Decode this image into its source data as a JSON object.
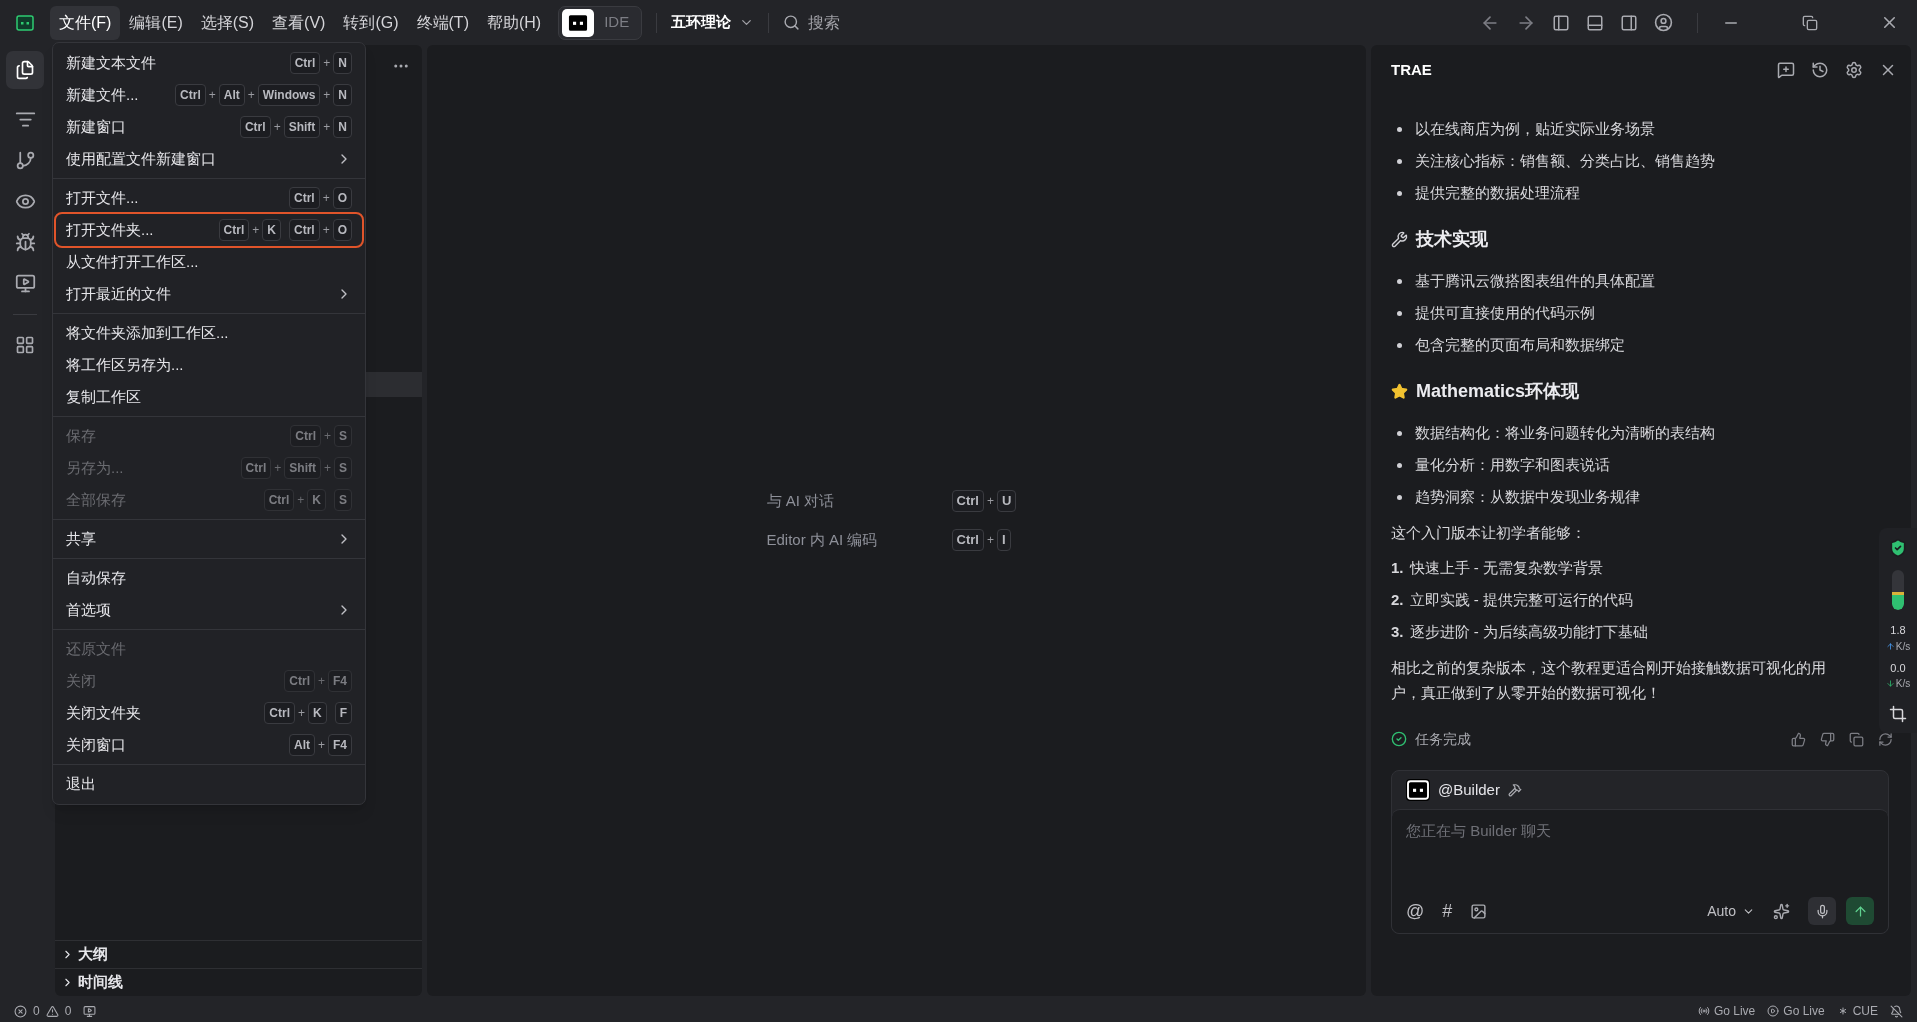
{
  "menubar": [
    {
      "label": "文件(F)",
      "selected": true
    },
    {
      "label": "编辑(E)",
      "selected": false
    },
    {
      "label": "选择(S)",
      "selected": false
    },
    {
      "label": "查看(V)",
      "selected": false
    },
    {
      "label": "转到(G)",
      "selected": false
    },
    {
      "label": "终端(T)",
      "selected": false
    },
    {
      "label": "帮助(H)",
      "selected": false
    }
  ],
  "mode_toggle": {
    "label": "IDE"
  },
  "project": {
    "name": "五环理论"
  },
  "search": {
    "placeholder": "搜索"
  },
  "file_menu": [
    [
      {
        "label": "新建文本文件",
        "disabled": false,
        "highlighted": false,
        "submenu": false,
        "shortcut": [
          [
            "Ctrl",
            "+",
            "N"
          ]
        ]
      },
      {
        "label": "新建文件...",
        "disabled": false,
        "highlighted": false,
        "submenu": false,
        "shortcut": [
          [
            "Ctrl",
            "+",
            "Alt",
            "+",
            "Windows",
            "+",
            "N"
          ]
        ]
      },
      {
        "label": "新建窗口",
        "disabled": false,
        "highlighted": false,
        "submenu": false,
        "shortcut": [
          [
            "Ctrl",
            "+",
            "Shift",
            "+",
            "N"
          ]
        ]
      },
      {
        "label": "使用配置文件新建窗口",
        "disabled": false,
        "highlighted": false,
        "submenu": true
      }
    ],
    [
      {
        "label": "打开文件...",
        "disabled": false,
        "highlighted": false,
        "submenu": false,
        "shortcut": [
          [
            "Ctrl",
            "+",
            "O"
          ]
        ]
      },
      {
        "label": "打开文件夹...",
        "disabled": false,
        "highlighted": true,
        "submenu": false,
        "shortcut": [
          [
            "Ctrl",
            "+",
            "K"
          ],
          [
            "Ctrl",
            "+",
            "O"
          ]
        ]
      },
      {
        "label": "从文件打开工作区...",
        "disabled": false,
        "highlighted": false,
        "submenu": false
      },
      {
        "label": "打开最近的文件",
        "disabled": false,
        "highlighted": false,
        "submenu": true
      }
    ],
    [
      {
        "label": "将文件夹添加到工作区...",
        "disabled": false,
        "highlighted": false,
        "submenu": false
      },
      {
        "label": "将工作区另存为...",
        "disabled": false,
        "highlighted": false,
        "submenu": false
      },
      {
        "label": "复制工作区",
        "disabled": false,
        "highlighted": false,
        "submenu": false
      }
    ],
    [
      {
        "label": "保存",
        "disabled": true,
        "highlighted": false,
        "submenu": false,
        "shortcut": [
          [
            "Ctrl",
            "+",
            "S"
          ]
        ]
      },
      {
        "label": "另存为...",
        "disabled": true,
        "highlighted": false,
        "submenu": false,
        "shortcut": [
          [
            "Ctrl",
            "+",
            "Shift",
            "+",
            "S"
          ]
        ]
      },
      {
        "label": "全部保存",
        "disabled": true,
        "highlighted": false,
        "submenu": false,
        "shortcut": [
          [
            "Ctrl",
            "+",
            "K"
          ],
          [
            "S"
          ]
        ]
      }
    ],
    [
      {
        "label": "共享",
        "disabled": false,
        "highlighted": false,
        "submenu": true
      }
    ],
    [
      {
        "label": "自动保存",
        "disabled": false,
        "highlighted": false,
        "submenu": false
      },
      {
        "label": "首选项",
        "disabled": false,
        "highlighted": false,
        "submenu": true
      }
    ],
    [
      {
        "label": "还原文件",
        "disabled": true,
        "highlighted": false,
        "submenu": false
      },
      {
        "label": "关闭",
        "disabled": true,
        "highlighted": false,
        "submenu": false,
        "shortcut": [
          [
            "Ctrl",
            "+",
            "F4"
          ]
        ]
      },
      {
        "label": "关闭文件夹",
        "disabled": false,
        "highlighted": false,
        "submenu": false,
        "shortcut": [
          [
            "Ctrl",
            "+",
            "K"
          ],
          [
            "F"
          ]
        ]
      },
      {
        "label": "关闭窗口",
        "disabled": false,
        "highlighted": false,
        "submenu": false,
        "shortcut": [
          [
            "Alt",
            "+",
            "F4"
          ]
        ]
      }
    ],
    [
      {
        "label": "退出",
        "disabled": false,
        "highlighted": false,
        "submenu": false
      }
    ]
  ],
  "sidebar_sections": [
    {
      "label": "大纲",
      "expanded": false
    },
    {
      "label": "时间线",
      "expanded": false
    }
  ],
  "editor_hints": [
    {
      "label": "与 AI 对话",
      "keys": [
        "Ctrl",
        "+",
        "U"
      ]
    },
    {
      "label": "Editor 内 AI 编码",
      "keys": [
        "Ctrl",
        "+",
        "I"
      ]
    }
  ],
  "chat": {
    "title": "TRAE",
    "blocks": [
      {
        "kind": "bullet",
        "text": "以在线商店为例，贴近实际业务场景"
      },
      {
        "kind": "bullet",
        "text": "关注核心指标：销售额、分类占比、销售趋势"
      },
      {
        "kind": "bullet",
        "text": "提供完整的数据处理流程"
      },
      {
        "kind": "heading",
        "text": "技术实现"
      },
      {
        "kind": "bullet",
        "text": "基于腾讯云微搭图表组件的具体配置"
      },
      {
        "kind": "bullet",
        "text": "提供可直接使用的代码示例"
      },
      {
        "kind": "bullet",
        "text": "包含完整的页面布局和数据绑定"
      },
      {
        "kind": "heading",
        "text": "Mathematics环体现"
      },
      {
        "kind": "bullet",
        "text": "数据结构化：将业务问题转化为清晰的表结构"
      },
      {
        "kind": "bullet",
        "text": "量化分析：用数字和图表说话"
      },
      {
        "kind": "bullet",
        "text": "趋势洞察：从数据中发现业务规律"
      },
      {
        "kind": "para",
        "text": "这个入门版本让初学者能够："
      },
      {
        "kind": "numbered",
        "number": "1.",
        "text": "快速上手 - 无需复杂数学背景"
      },
      {
        "kind": "numbered",
        "number": "2.",
        "text": "立即实践 - 提供完整可运行的代码"
      },
      {
        "kind": "numbered",
        "number": "3.",
        "text": "逐步进阶 - 为后续高级功能打下基础"
      },
      {
        "kind": "para",
        "text": "相比之前的复杂版本，这个教程更适合刚开始接触数据可视化的用户，真正做到了从零开始的数据可视化！"
      }
    ],
    "status": "任务完成",
    "agent": "@Builder",
    "input": {
      "placeholder": "您正在与 Builder 聊天"
    },
    "tools": [
      "@",
      "#"
    ],
    "model": "Auto"
  },
  "monitor": {
    "level": 0.45,
    "upload": "1.8",
    "upload_unit": "K/s",
    "download": "0.0",
    "download_unit": "K/s"
  },
  "status_bar": {
    "errors": "0",
    "warnings": "0",
    "right": [
      "Go Live",
      "Go Live",
      "CUE"
    ]
  }
}
